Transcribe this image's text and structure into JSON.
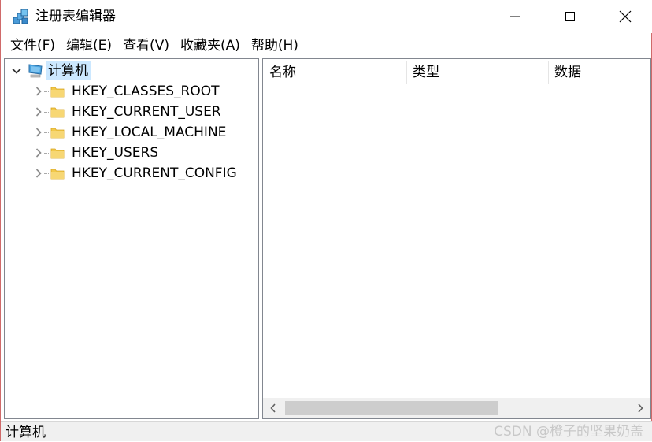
{
  "window": {
    "title": "注册表编辑器"
  },
  "menu": {
    "items": [
      "文件(F)",
      "编辑(E)",
      "查看(V)",
      "收藏夹(A)",
      "帮助(H)"
    ]
  },
  "tree": {
    "root_label": "计算机",
    "children": [
      "HKEY_CLASSES_ROOT",
      "HKEY_CURRENT_USER",
      "HKEY_LOCAL_MACHINE",
      "HKEY_USERS",
      "HKEY_CURRENT_CONFIG"
    ]
  },
  "list": {
    "columns": [
      "名称",
      "类型",
      "数据"
    ]
  },
  "status": {
    "path": "计算机"
  },
  "watermark": "CSDN @橙子的坚果奶盖",
  "colors": {
    "selection": "#cce8ff",
    "folder": "#f6d365",
    "border": "#828790"
  }
}
